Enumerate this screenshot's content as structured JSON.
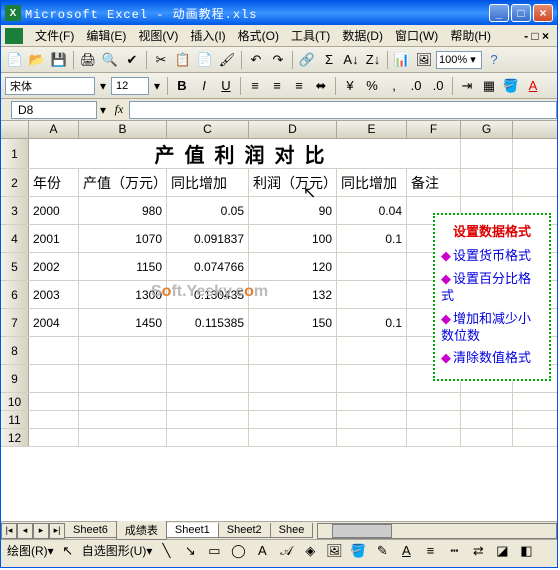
{
  "window": {
    "title": "Microsoft Excel - 动画教程.xls"
  },
  "menu": [
    "文件(F)",
    "编辑(E)",
    "视图(V)",
    "插入(I)",
    "格式(O)",
    "工具(T)",
    "数据(D)",
    "窗口(W)",
    "帮助(H)"
  ],
  "toolbar": {
    "zoom": "100%"
  },
  "format": {
    "font": "宋体",
    "size": "12"
  },
  "namebox": "D8",
  "cols": [
    "A",
    "B",
    "C",
    "D",
    "E",
    "F",
    "G"
  ],
  "title_row": "产值利润对比",
  "headers": [
    "年份",
    "产值（万元）",
    "同比增加",
    "利润（万元）",
    "同比增加",
    "备注"
  ],
  "rows": [
    {
      "a": "2000",
      "b": "980",
      "c": "0.05",
      "d": "90",
      "e": "0.04"
    },
    {
      "a": "2001",
      "b": "1070",
      "c": "0.091837",
      "d": "100",
      "e": "0.1"
    },
    {
      "a": "2002",
      "b": "1150",
      "c": "0.074766",
      "d": "120",
      "e": ""
    },
    {
      "a": "2003",
      "b": "1300",
      "c": "0.130435",
      "d": "132",
      "e": ""
    },
    {
      "a": "2004",
      "b": "1450",
      "c": "0.115385",
      "d": "150",
      "e": "0.1"
    }
  ],
  "callout": {
    "title": "设置数据格式",
    "items": [
      "设置货币格式",
      "设置百分比格式",
      "增加和减少小数位数",
      "清除数值格式"
    ]
  },
  "sheets": [
    "Sheet6",
    "成绩表",
    "Sheet1",
    "Sheet2",
    "Shee"
  ],
  "statusbar": {
    "draw": "绘图(R)▾",
    "autoshape": "自选图形(U)▾"
  },
  "watermark": "Soft.Yesky.com"
}
